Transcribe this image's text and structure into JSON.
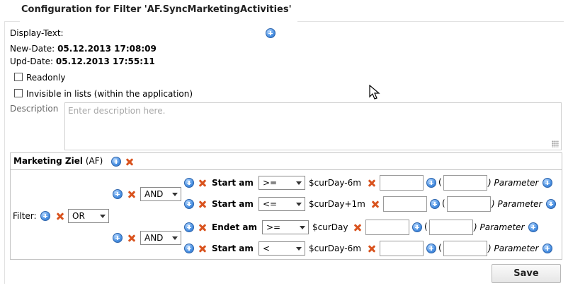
{
  "header": {
    "title": "Configuration for Filter 'AF.SyncMarketingActivities'"
  },
  "meta": {
    "display_text_label": "Display-Text:",
    "new_date_label": "New-Date:",
    "new_date_value": "05.12.2013 17:08:09",
    "upd_date_label": "Upd-Date:",
    "upd_date_value": "05.12.2013 17:55:11"
  },
  "options": {
    "readonly_label": "Readonly",
    "invisible_label": "Invisible in lists (within the application)"
  },
  "description": {
    "label": "Description",
    "placeholder": "Enter description here."
  },
  "filter_group": {
    "name": "Marketing Ziel",
    "suffix": "(AF)",
    "filter_label": "Filter:",
    "root_operator": "OR",
    "groups": [
      {
        "operator": "AND",
        "conditions": [
          {
            "field": "Start am",
            "comparator": ">=",
            "value": "$curDay-6m",
            "open_paren": "(",
            "close_paren": ")",
            "param_label": "Parameter"
          },
          {
            "field": "Start am",
            "comparator": "<=",
            "value": "$curDay+1m",
            "open_paren": "(",
            "close_paren": ")",
            "param_label": "Parameter"
          }
        ]
      },
      {
        "operator": "AND",
        "conditions": [
          {
            "field": "Endet am",
            "comparator": ">=",
            "value": "$curDay",
            "open_paren": "(",
            "close_paren": ")",
            "param_label": "Parameter"
          },
          {
            "field": "Start am",
            "comparator": "<",
            "value": "$curDay-6m",
            "open_paren": "(",
            "close_paren": ")",
            "param_label": "Parameter"
          }
        ]
      }
    ]
  },
  "actions": {
    "save_label": "Save"
  },
  "colors": {
    "accent_blue": "#4a90e2",
    "delete_orange": "#d9531e"
  }
}
